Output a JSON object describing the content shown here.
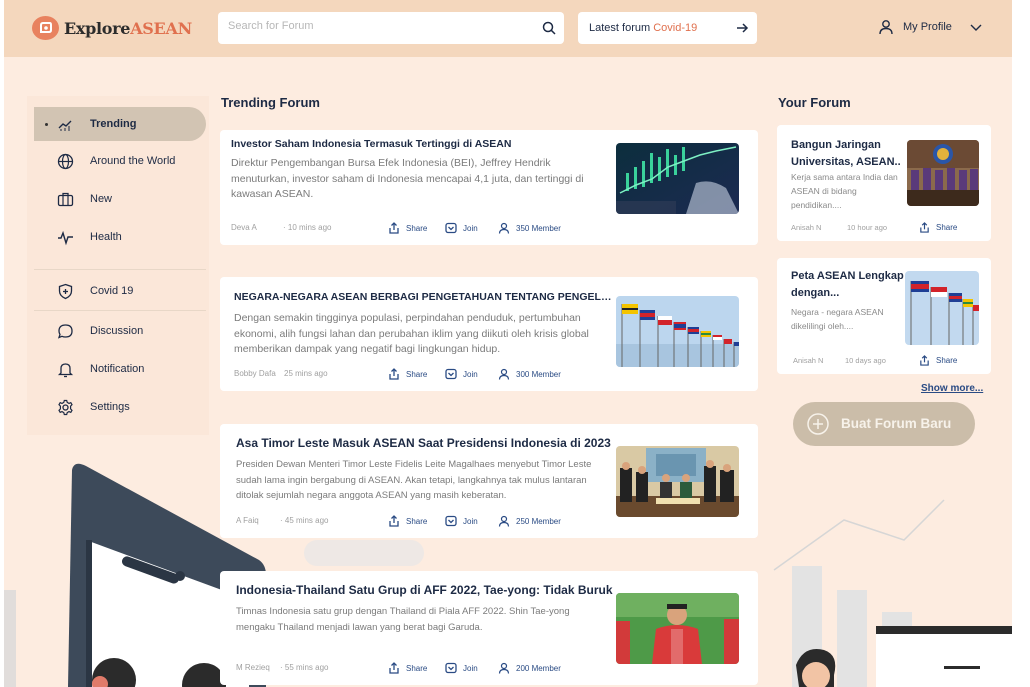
{
  "header": {
    "logo": {
      "part1": "Explore",
      "part2": "ASEAN"
    },
    "search": {
      "placeholder": "Search for Forum",
      "value": ""
    },
    "latest": {
      "label": "Latest forum ",
      "value": "Covid-19"
    },
    "profile": {
      "label": "My Profile"
    }
  },
  "sidebar": {
    "items": [
      {
        "label": "Trending",
        "icon": "trending-icon",
        "active": true
      },
      {
        "label": "Around the World",
        "icon": "globe-icon"
      },
      {
        "label": "New",
        "icon": "briefcase-icon"
      },
      {
        "label": "Health",
        "icon": "pulse-icon"
      },
      {
        "label": "Covid 19",
        "icon": "shield-icon"
      },
      {
        "label": "Discussion",
        "icon": "chat-icon"
      },
      {
        "label": "Notification",
        "icon": "bell-icon"
      },
      {
        "label": "Settings",
        "icon": "gear-icon"
      }
    ]
  },
  "trending": {
    "title": "Trending Forum",
    "share_label": "Share",
    "join_label": "Join",
    "posts": [
      {
        "title": "Investor Saham Indonesia Termasuk Tertinggi di ASEAN",
        "description": "Direktur Pengembangan Bursa Efek Indonesia (BEI), Jeffrey Hendrik menuturkan, investor saham di Indonesia mencapai 4,1 juta, dan tertinggi di kawasan ASEAN.",
        "author": "Deva A",
        "time": "· 10 mins ago",
        "members": "350 Member"
      },
      {
        "title": "NEGARA-NEGARA ASEAN BERBAGI PENGETAHUAN TENTANG PENGELOLA...",
        "description": "Dengan semakin tingginya populasi, perpindahan penduduk, pertumbuhan ekonomi, alih fungsi lahan dan perubahan iklim yang diikuti oleh krisis global memberikan dampak yang negatif bagi lingkungan hidup.",
        "author": "Bobby Dafa",
        "time": "25 mins ago",
        "members": "300 Member"
      },
      {
        "title": "Asa Timor Leste Masuk ASEAN Saat Presidensi Indonesia di 2023",
        "description": "Presiden Dewan Menteri Timor Leste Fidelis Leite Magalhaes menyebut Timor Leste sudah lama ingin bergabung di ASEAN. Akan tetapi, langkahnya tak mulus lantaran ditolak sejumlah negara anggota ASEAN yang masih keberatan.",
        "author": "A Faiq",
        "time": "· 45 mins ago",
        "members": "250 Member"
      },
      {
        "title": "Indonesia-Thailand Satu Grup di AFF 2022, Tae-yong: Tidak Buruk",
        "description": "Timnas Indonesia satu grup dengan Thailand di Piala AFF 2022. Shin Tae-yong mengaku Thailand menjadi lawan yang berat bagi Garuda.",
        "author": "M Rezieq",
        "time": "· 55 mins ago",
        "members": "200 Member"
      }
    ]
  },
  "your_forum": {
    "title": "Your Forum",
    "share_label": "Share",
    "posts": [
      {
        "title": "Bangun Jaringan Universitas, ASEAN..",
        "description": "Kerja sama antara India dan ASEAN di bidang pendidikan....",
        "author": "Anisah N",
        "time": "10 hour ago"
      },
      {
        "title": "Peta ASEAN Lengkap dengan...",
        "description": "Negara - negara ASEAN dikelilingi oleh....",
        "author": "Anisah N",
        "time": "10 days ago"
      }
    ],
    "show_more": "Show more...",
    "create_button": "Buat Forum Baru"
  },
  "colors": {
    "header_bg": "#f4d7bd",
    "page_bg": "#fdece0",
    "accent": "#e0704e",
    "link": "#2a4b84",
    "active_nav": "#d2c4b3",
    "create_button": "#cbbda9"
  }
}
